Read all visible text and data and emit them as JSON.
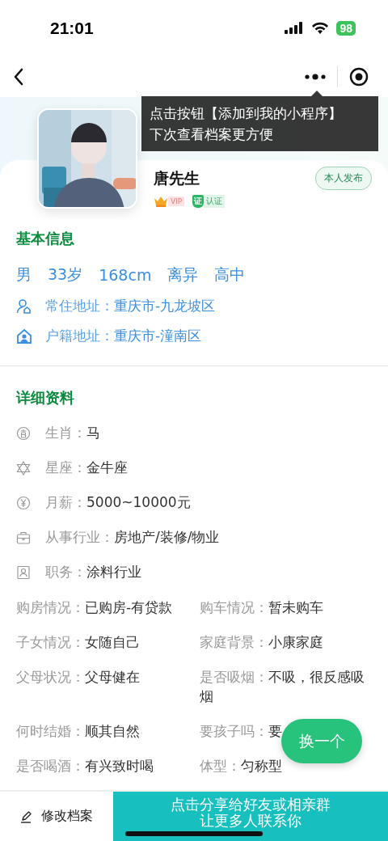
{
  "status_bar": {
    "time": "21:01",
    "battery": "98"
  },
  "tooltip": {
    "lines": [
      "点击按钮【添加到我的小程序】",
      "下次查看档案更方便"
    ]
  },
  "profile": {
    "name": "唐先生",
    "badges": [
      {
        "kind": "vip",
        "label": "VIP"
      },
      {
        "kind": "verified",
        "icon": "证",
        "label": "认证"
      }
    ],
    "publisher_tag": "本人发布"
  },
  "basic_info": {
    "title": "基本信息",
    "tags": [
      "男",
      "33岁",
      "168cm",
      "离异",
      "高中"
    ],
    "addresses": [
      {
        "kind": "residence",
        "label": "常住地址：",
        "value": "重庆市-九龙坡区"
      },
      {
        "kind": "household",
        "label": "户籍地址：",
        "value": "重庆市-潼南区"
      }
    ]
  },
  "details": {
    "title": "详细资料",
    "rows": [
      {
        "kind": "zodiac",
        "label": "生肖：",
        "value": "马"
      },
      {
        "kind": "star",
        "label": "星座：",
        "value": "金牛座"
      },
      {
        "kind": "salary",
        "label": "月薪：",
        "value": "5000~10000元"
      },
      {
        "kind": "industry",
        "label": "从事行业：",
        "value": "房地产/装修/物业"
      },
      {
        "kind": "position",
        "label": "职务：",
        "value": "涂料行业"
      }
    ],
    "pairs": [
      {
        "label": "购房情况：",
        "value": "已购房-有贷款"
      },
      {
        "label": "购车情况：",
        "value": "暂未购车"
      },
      {
        "label": "子女情况：",
        "value": "女随自己"
      },
      {
        "label": "家庭背景：",
        "value": "小康家庭"
      },
      {
        "label": "父母状况：",
        "value": "父母健在"
      },
      {
        "label": "是否吸烟：",
        "value": "不吸，很反感吸烟"
      },
      {
        "label": "何时结婚：",
        "value": "顺其自然"
      },
      {
        "label": "要孩子吗：",
        "value": "要"
      },
      {
        "label": "是否喝酒：",
        "value": "有兴致时喝"
      },
      {
        "label": "体型：",
        "value": "匀称型"
      }
    ]
  },
  "float_button": "换一个",
  "bottom_bar": {
    "edit": "修改档案",
    "share_lines": [
      "点击分享给好友或相亲群",
      "让更多人联系你"
    ]
  }
}
